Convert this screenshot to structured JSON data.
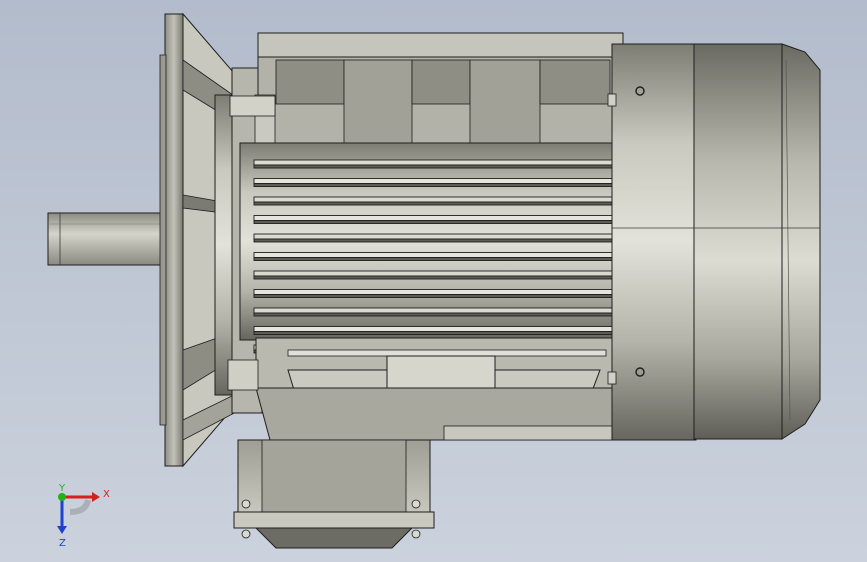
{
  "viewport": {
    "background_top": "#b3bccc",
    "background_bottom": "#cbd2dd",
    "model": "electric-motor",
    "view": "side"
  },
  "triad": {
    "x_label": "X",
    "y_label": "Y",
    "z_label": "Z",
    "x_color": "#d42020",
    "y_color": "#20b020",
    "z_color": "#2040d0"
  },
  "colors": {
    "metal_light": "#d5d5cc",
    "metal_mid": "#a9a99f",
    "metal_dark": "#6e6e66",
    "edge": "#1e1e1e"
  }
}
